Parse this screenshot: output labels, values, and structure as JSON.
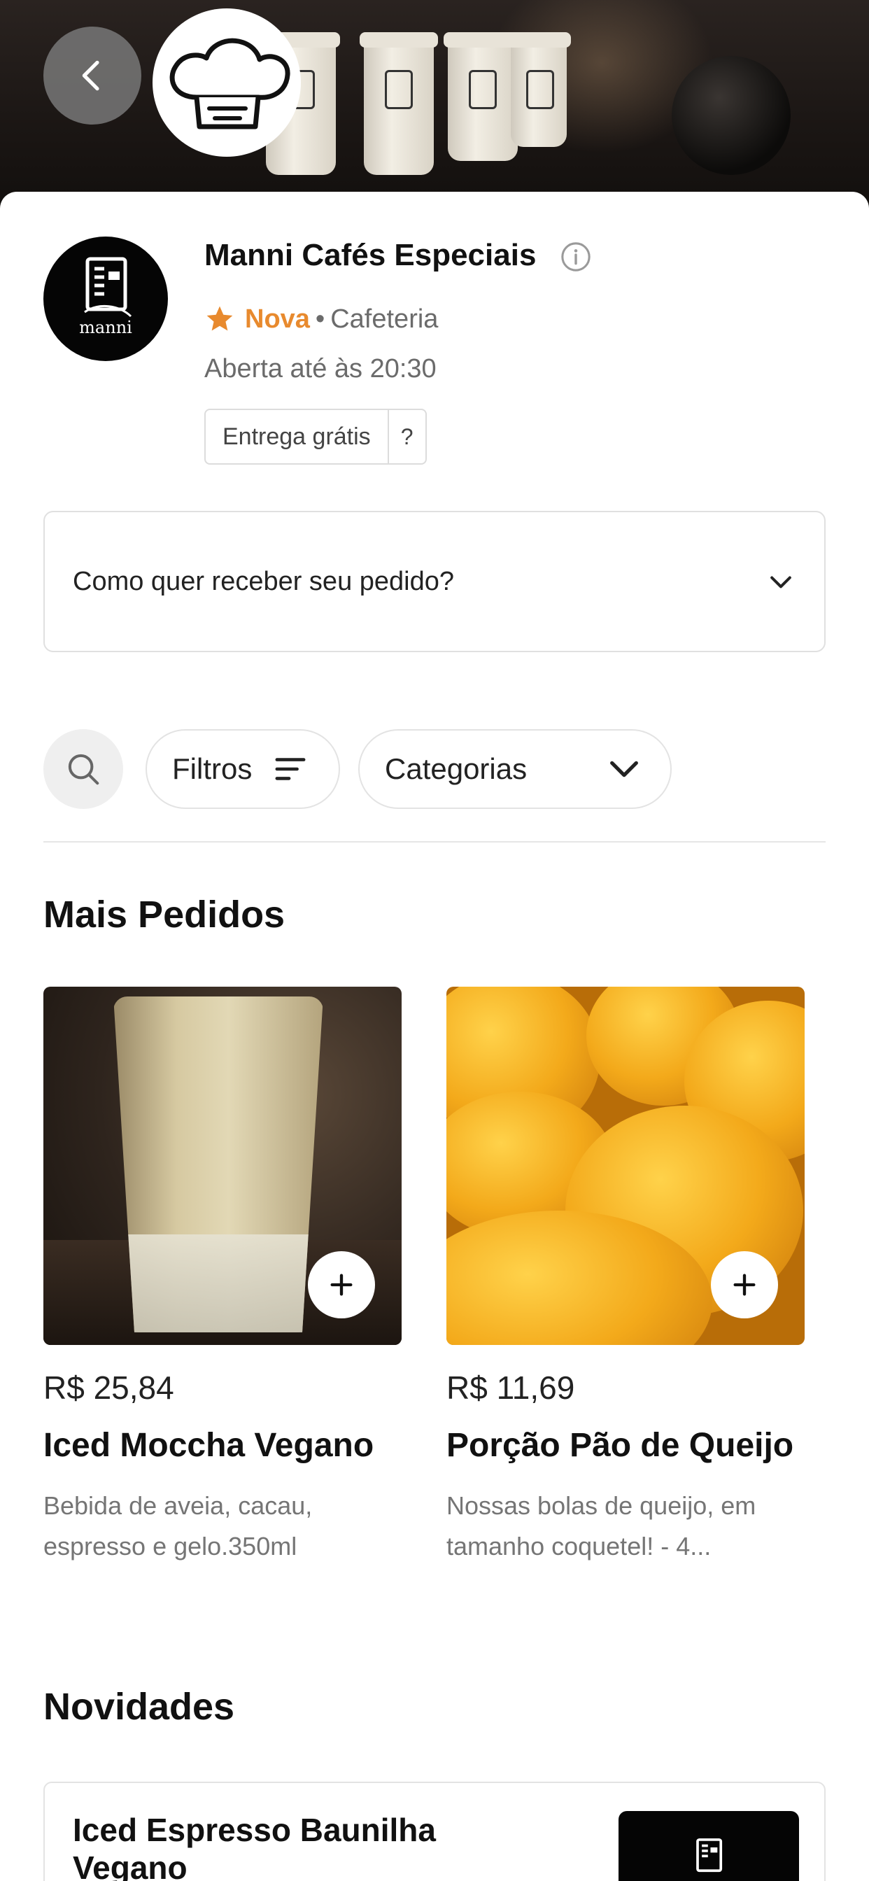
{
  "store": {
    "name": "Manni Cafés Especiais",
    "rating_label": "Nova",
    "category": "Cafeteria",
    "separator": "•",
    "open_hours": "Aberta até às 20:30",
    "delivery_tag": "Entrega grátis",
    "delivery_help": "?",
    "logo_text": "manni"
  },
  "receive": {
    "label": "Como quer receber seu pedido?"
  },
  "toolbar": {
    "filters_label": "Filtros",
    "categories_label": "Categorias"
  },
  "sections": {
    "most_ordered": "Mais Pedidos",
    "news": "Novidades"
  },
  "products": [
    {
      "price": "R$ 25,84",
      "name": "Iced Moccha Vegano",
      "description": "Bebida de aveia, cacau, espresso e gelo.350ml"
    },
    {
      "price": "R$ 11,69",
      "name": "Porção Pão de Queijo",
      "description": "Nossas bolas de queijo, em tamanho coquetel! - 4..."
    }
  ],
  "news_items": [
    {
      "name": "Iced Espresso Baunilha Vegano"
    }
  ],
  "colors": {
    "accent_orange": "#e88a2e",
    "text_primary": "#111111",
    "text_secondary": "#6b6b6b",
    "border": "#e0e0e0"
  },
  "icons": {
    "back": "chevron-left-icon",
    "brand": "chef-hat-icon",
    "info": "info-icon",
    "rating": "star-icon",
    "dropdown": "chevron-down-icon",
    "search": "search-icon",
    "filters": "filter-lines-icon",
    "add": "plus-icon"
  }
}
